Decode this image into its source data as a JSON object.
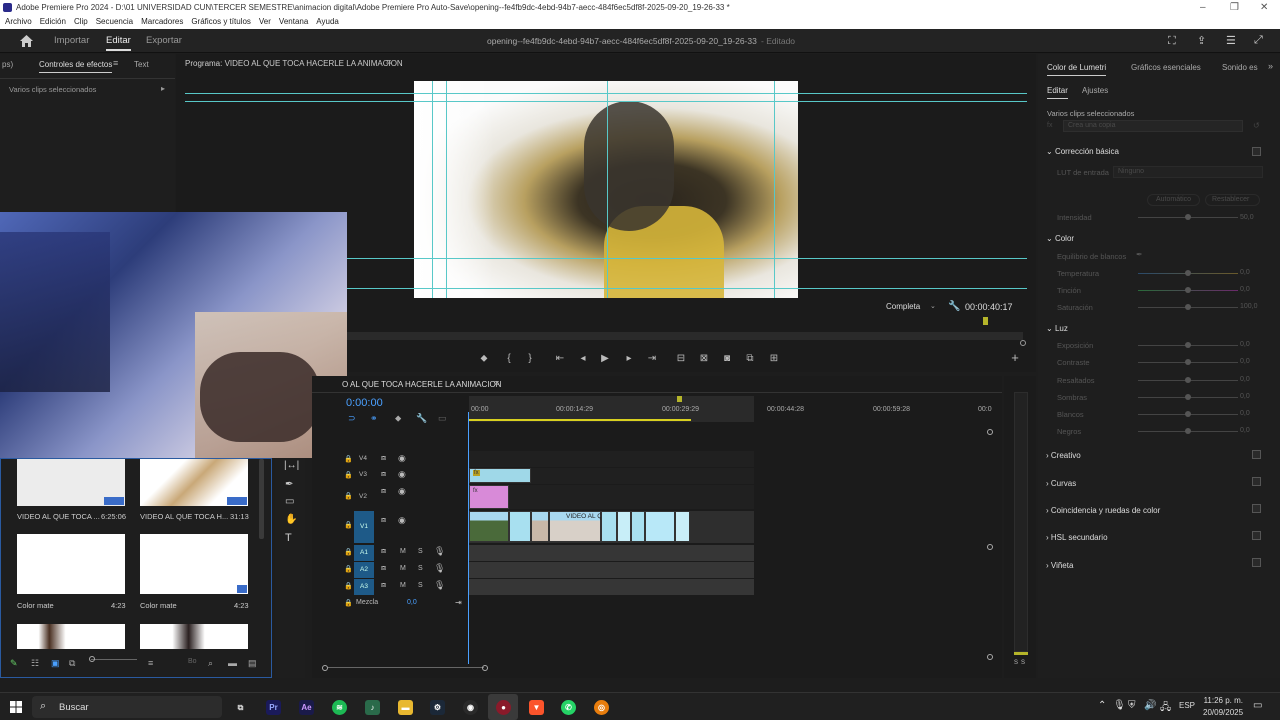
{
  "window": {
    "title": "Adobe Premiere Pro 2024 - D:\\01 UNIVERSIDAD CUN\\TERCER SEMESTRE\\animacion digital\\Adobe Premiere Pro Auto-Save\\opening--fe4fb9dc-4ebd-94b7-aecc-484f6ec5df8f-2025-09-20_19-26-33 *"
  },
  "menu": [
    "Archivo",
    "Edición",
    "Clip",
    "Secuencia",
    "Marcadores",
    "Gráficos y títulos",
    "Ver",
    "Ventana",
    "Ayuda"
  ],
  "header": {
    "tabs": [
      "Importar",
      "Editar",
      "Exportar"
    ],
    "active_tab": "Editar",
    "doc_title": "opening--fe4fb9dc-4ebd-94b7-aecc-484f6ec5df8f-2025-09-20_19-26-33",
    "doc_status": "- Editado"
  },
  "left_panel": {
    "tab_partial": "ps)",
    "tab_effect_controls": "Controles de efectos",
    "tab_text": "Text",
    "selection": "Varios clips seleccionados"
  },
  "program_monitor": {
    "title": "Programa: VIDEO AL QUE TOCA HACERLE LA ANIMACION",
    "quality": "Completa",
    "timecode": "00:00:40:17"
  },
  "project_items": [
    {
      "name": "VIDEO AL QUE TOCA ...",
      "duration": "6:25:06"
    },
    {
      "name": "VIDEO AL QUE TOCA H...",
      "duration": "31:13"
    },
    {
      "name": "Color mate",
      "duration": "4:23"
    },
    {
      "name": "Color mate",
      "duration": "4:23"
    }
  ],
  "project_footer": {
    "partial_label": "Bo"
  },
  "timeline": {
    "title": "O AL QUE TOCA HACERLE LA ANIMACION",
    "timecode": "0:00:00",
    "ruler_labels": [
      "00:00",
      "00:00:14:29",
      "00:00:29:29",
      "00:00:44:28",
      "00:00:59:28",
      "00:0"
    ],
    "video_tracks": [
      "V4",
      "V3",
      "V2",
      "V1"
    ],
    "audio_tracks": [
      "A1",
      "A2",
      "A3"
    ],
    "mute_label": "M",
    "solo_label": "S",
    "mix_label": "Mezcla",
    "mix_value": "0,0",
    "clip_label": "VIDEO AL QUE T",
    "fx_label": "fx",
    "meter_labels": [
      "S",
      "S"
    ]
  },
  "lumetri": {
    "tabs": [
      "Color de Lumetri",
      "Gráficos esenciales",
      "Sonido es"
    ],
    "subtabs": [
      "Editar",
      "Ajustes"
    ],
    "selection": "Varios clips seleccionados",
    "clip_dropdown": "Crea una copia",
    "basic": "Corrección básica",
    "lut_label": "LUT de entrada",
    "lut_value": "Ninguno",
    "auto_btn": "Automático",
    "reset_btn": "Restablecer",
    "intensity_label": "Intensidad",
    "intensity_value": "50,0",
    "color_label": "Color",
    "wb_label": "Equilibrio de blancos",
    "temp_label": "Temperatura",
    "temp_value": "0,0",
    "tint_label": "Tinción",
    "tint_value": "0,0",
    "sat_label": "Saturación",
    "sat_value": "100,0",
    "light_label": "Luz",
    "exposure_label": "Exposición",
    "exposure_value": "0,0",
    "contrast_label": "Contraste",
    "contrast_value": "0,0",
    "highlights_label": "Resaltados",
    "highlights_value": "0,0",
    "shadows_label": "Sombras",
    "shadows_value": "0,0",
    "whites_label": "Blancos",
    "whites_value": "0,0",
    "blacks_label": "Negros",
    "blacks_value": "0,0",
    "creative": "Creativo",
    "curves": "Curvas",
    "match": "Coincidencia y ruedas de color",
    "hsl": "HSL secundario",
    "vignette": "Viñeta"
  },
  "taskbar": {
    "search_placeholder": "Buscar",
    "lang": "ESP",
    "time": "11:26 p. m.",
    "date": "20/09/2025"
  }
}
